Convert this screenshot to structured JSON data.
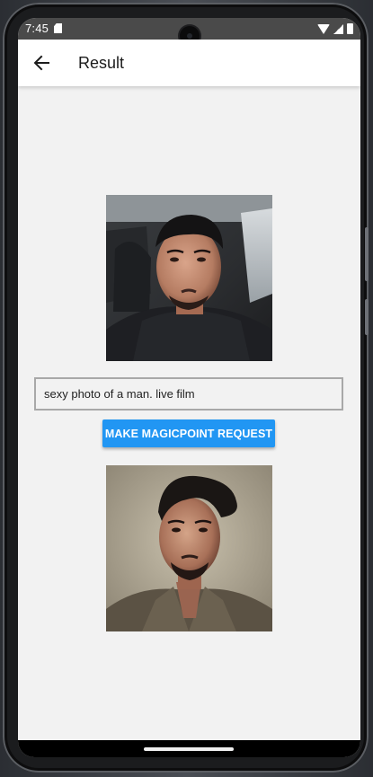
{
  "status_bar": {
    "time": "7:45",
    "icons": [
      "sd-card-icon",
      "wifi-icon",
      "signal-icon",
      "battery-icon"
    ]
  },
  "app_bar": {
    "title": "Result",
    "back_icon": "arrow-left-icon"
  },
  "prompt": {
    "value": "sexy photo of a man. live film",
    "placeholder": ""
  },
  "request_button": {
    "label": "MAKE MAGICPOINT REQUEST"
  },
  "colors": {
    "accent": "#2196f3",
    "background": "#f2f2f2",
    "app_bar": "#ffffff",
    "status_bar": "#4a4a4a"
  }
}
